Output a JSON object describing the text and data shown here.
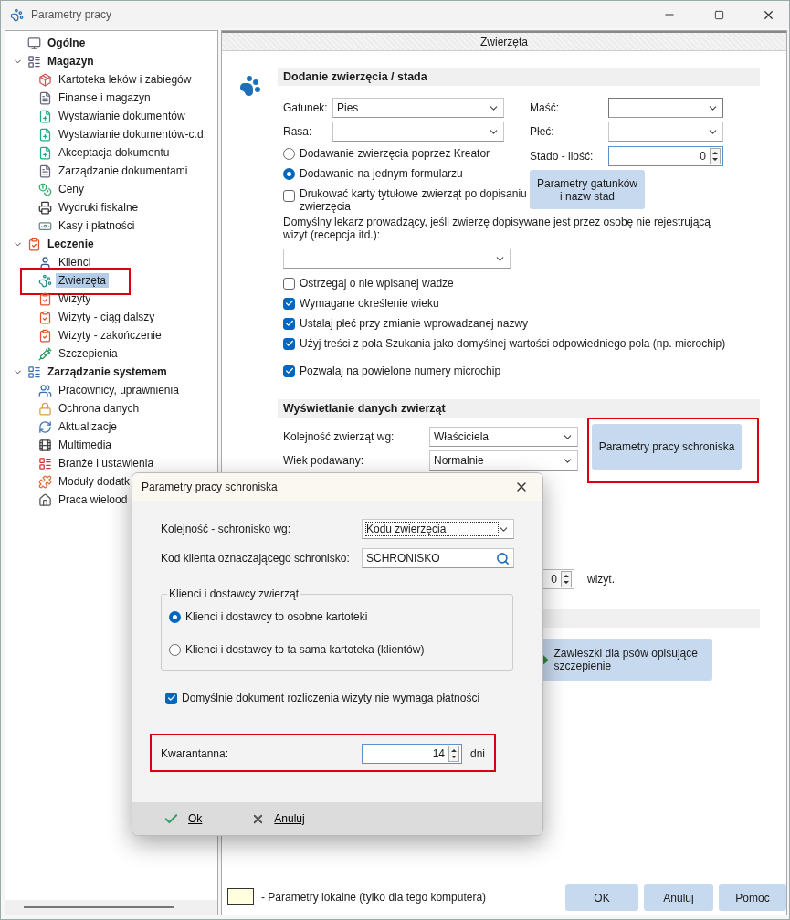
{
  "window": {
    "title": "Parametry pracy"
  },
  "sidebar": {
    "items": [
      {
        "label": "Ogólne",
        "selected": false
      },
      {
        "label": "Magazyn",
        "selected": false,
        "expanded": true,
        "children": [
          {
            "label": "Kartoteka leków i zabiegów",
            "selected": false
          },
          {
            "label": "Finanse i magazyn",
            "selected": false
          },
          {
            "label": "Wystawianie dokumentów",
            "selected": false
          },
          {
            "label": "Wystawianie dokumentów-c.d.",
            "selected": false
          },
          {
            "label": "Akceptacja dokumentu",
            "selected": false
          },
          {
            "label": "Zarządzanie dokumentami",
            "selected": false
          },
          {
            "label": "Ceny",
            "selected": false
          },
          {
            "label": "Wydruki fiskalne",
            "selected": false
          },
          {
            "label": "Kasy i płatności",
            "selected": false
          }
        ]
      },
      {
        "label": "Leczenie",
        "selected": false,
        "expanded": true,
        "children": [
          {
            "label": "Klienci",
            "selected": false
          },
          {
            "label": "Zwierzęta",
            "selected": true,
            "highlighted": true
          },
          {
            "label": "Wizyty",
            "selected": false
          },
          {
            "label": "Wizyty - ciąg dalszy",
            "selected": false
          },
          {
            "label": "Wizyty - zakończenie",
            "selected": false
          },
          {
            "label": "Szczepienia",
            "selected": false
          }
        ]
      },
      {
        "label": "Zarządzanie systemem",
        "selected": false,
        "expanded": true,
        "children": [
          {
            "label": "Pracownicy, uprawnienia",
            "selected": false
          },
          {
            "label": "Ochrona danych",
            "selected": false
          },
          {
            "label": "Aktualizacje",
            "selected": false
          },
          {
            "label": "Multimedia",
            "selected": false
          },
          {
            "label": "Branże i ustawienia",
            "selected": false
          },
          {
            "label": "Moduły dodatk",
            "selected": false
          },
          {
            "label": "Praca wielood",
            "selected": false
          }
        ]
      }
    ]
  },
  "page": {
    "tab": "Zwierzęta",
    "adding": {
      "header": "Dodanie zwierzęcia / stada",
      "species": {
        "label": "Gatunek:",
        "value": "Pies"
      },
      "breed": {
        "label": "Rasa:"
      },
      "coat": {
        "label": "Maść:"
      },
      "sex": {
        "label": "Płeć:"
      },
      "herd": {
        "label": "Stado - ilość:",
        "value": "0"
      },
      "modes": [
        {
          "label": "Dodawanie zwierzęcia poprzez Kreator",
          "selected": false
        },
        {
          "label": "Dodawanie na jednym formularzu",
          "selected": true
        }
      ],
      "species_button": "Parametry gatunków i nazw stad",
      "print_cards": {
        "label": "Drukować karty tytułowe zwierząt po dopisaniu zwierzęcia",
        "checked": false
      },
      "doctor": {
        "label": "Domyślny lekarz prowadzący, jeśli  zwierzę dopisywane jest przez osobę nie rejestrującą wizyt (recepcja itd.):"
      },
      "options": [
        {
          "label": "Ostrzegaj o nie wpisanej wadze",
          "checked": false
        },
        {
          "label": "Wymagane określenie wieku",
          "checked": true
        },
        {
          "label": "Ustalaj płeć przy zmianie wprowadzanej nazwy",
          "checked": true
        },
        {
          "label": "Użyj treści z pola Szukania jako domyślnej wartości odpowiedniego pola  (np. microchip)",
          "checked": true
        },
        {
          "label": "Pozwalaj na powielone numery microchip",
          "checked": true
        }
      ]
    },
    "display": {
      "header": "Wyświetlanie danych zwierząt",
      "order": {
        "label": "Kolejność zwierząt wg:",
        "value": "Właściciela"
      },
      "age": {
        "label": "Wiek podawany:",
        "value": "Normalnie"
      },
      "shelter_button": {
        "label": "Parametry pracy schroniska",
        "highlighted": true
      },
      "visits": {
        "value": "0",
        "unit": "wizyt."
      }
    },
    "tags_button": "Zawieszki dla psów opisujące szczepienie",
    "legend": "- Parametry lokalne (tylko dla tego komputera)",
    "buttons": [
      "OK",
      "Anuluj",
      "Pomoc"
    ]
  },
  "dialog": {
    "title": "Parametry pracy schroniska",
    "order": {
      "label": "Kolejność - schronisko wg:",
      "value": "Kodu zwierzęcia"
    },
    "client_code": {
      "label": "Kod klienta oznaczającego schronisko:",
      "value": "SCHRONISKO"
    },
    "group": {
      "legend": "Klienci i dostawcy zwierząt",
      "options": [
        {
          "label": "Klienci i dostawcy to osobne kartoteki",
          "selected": true
        },
        {
          "label": "Klienci i dostawcy to ta sama kartoteka (klientów)",
          "selected": false
        }
      ]
    },
    "no_payment": {
      "label": "Domyślnie dokument rozliczenia wizyty nie wymaga płatności",
      "checked": true
    },
    "quarantine": {
      "label": "Kwarantanna:",
      "value": "14",
      "unit": "dni",
      "highlighted": true
    },
    "buttons": [
      {
        "label": "Ok",
        "kind": "ok"
      },
      {
        "label": "Anuluj",
        "kind": "cancel"
      }
    ]
  }
}
